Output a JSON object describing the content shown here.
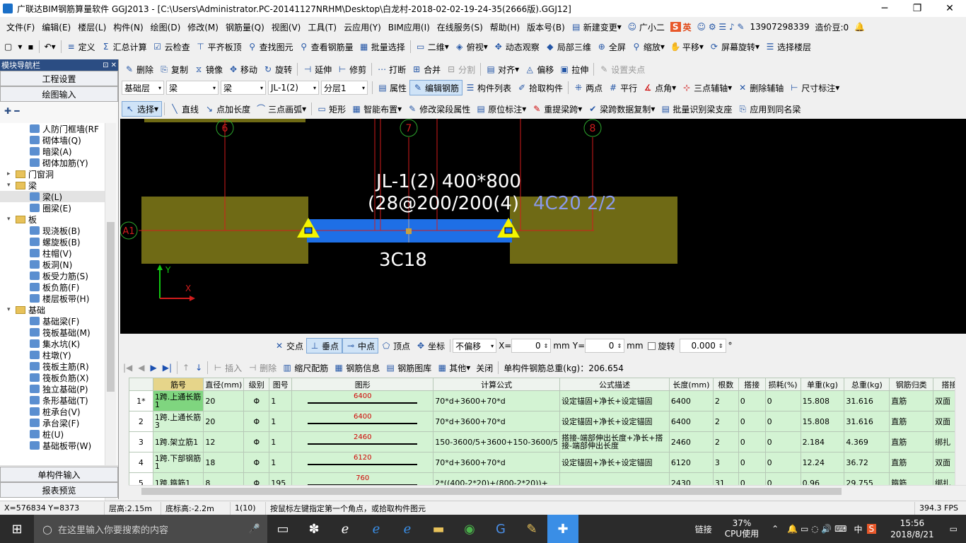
{
  "window": {
    "title": "广联达BIM钢筋算量软件 GGJ2013 - [C:\\Users\\Administrator.PC-20141127NRHM\\Desktop\\白龙村-2018-02-02-19-24-35(2666版).GGJ12]"
  },
  "menu": [
    "文件(F)",
    "编辑(E)",
    "楼层(L)",
    "构件(N)",
    "绘图(D)",
    "修改(M)",
    "钢筋量(Q)",
    "视图(V)",
    "工具(T)",
    "云应用(Y)",
    "BIM应用(I)",
    "在线服务(S)",
    "帮助(H)",
    "版本号(B)"
  ],
  "menu_right": {
    "new_change": "新建变更",
    "guang": "广小二",
    "ime": "英",
    "phone": "13907298339",
    "price": "造价豆:0"
  },
  "toolbar1": [
    "定义",
    "汇总计算",
    "云检查",
    "平齐板顶",
    "查找图元",
    "查看钢筋量",
    "批量选择",
    "二维",
    "俯视",
    "动态观察",
    "局部三维",
    "全屏",
    "缩放",
    "平移",
    "屏幕旋转",
    "选择楼层"
  ],
  "toolbar2": [
    "删除",
    "复制",
    "镜像",
    "移动",
    "旋转",
    "延伸",
    "修剪",
    "打断",
    "合并",
    "分割",
    "对齐",
    "偏移",
    "拉伸",
    "设置夹点"
  ],
  "toolbar3": {
    "floor": "基础层",
    "cat1": "梁",
    "cat2": "梁",
    "elem": "JL-1(2)",
    "layer": "分层1",
    "items": [
      "属性",
      "编辑钢筋",
      "构件列表",
      "拾取构件",
      "两点",
      "平行",
      "点角",
      "三点辅轴",
      "删除辅轴",
      "尺寸标注"
    ]
  },
  "toolbar4": [
    "选择",
    "直线",
    "点加长度",
    "三点画弧",
    "矩形",
    "智能布置",
    "修改梁段属性",
    "原位标注",
    "重提梁跨",
    "梁跨数据复制",
    "批量识别梁支座",
    "应用到同名梁"
  ],
  "nav": {
    "header": "模块导航栏",
    "buttons": [
      "工程设置",
      "绘图输入"
    ],
    "bottom": [
      "单构件输入",
      "报表预览"
    ],
    "tree": [
      {
        "label": "人防门框墙(RF",
        "indent": 3,
        "type": "item"
      },
      {
        "label": "砌体墙(Q)",
        "indent": 3,
        "type": "item"
      },
      {
        "label": "暗梁(A)",
        "indent": 3,
        "type": "item"
      },
      {
        "label": "砌体加筋(Y)",
        "indent": 3,
        "type": "item"
      },
      {
        "label": "门窗洞",
        "indent": 1,
        "type": "folder",
        "exp": ">"
      },
      {
        "label": "梁",
        "indent": 1,
        "type": "folder",
        "exp": "v"
      },
      {
        "label": "梁(L)",
        "indent": 3,
        "type": "item",
        "sel": true
      },
      {
        "label": "圈梁(E)",
        "indent": 3,
        "type": "item"
      },
      {
        "label": "板",
        "indent": 1,
        "type": "folder",
        "exp": "v"
      },
      {
        "label": "现浇板(B)",
        "indent": 3,
        "type": "item"
      },
      {
        "label": "螺旋板(B)",
        "indent": 3,
        "type": "item"
      },
      {
        "label": "柱帽(V)",
        "indent": 3,
        "type": "item"
      },
      {
        "label": "板洞(N)",
        "indent": 3,
        "type": "item"
      },
      {
        "label": "板受力筋(S)",
        "indent": 3,
        "type": "item"
      },
      {
        "label": "板负筋(F)",
        "indent": 3,
        "type": "item"
      },
      {
        "label": "楼层板带(H)",
        "indent": 3,
        "type": "item"
      },
      {
        "label": "基础",
        "indent": 1,
        "type": "folder",
        "exp": "v"
      },
      {
        "label": "基础梁(F)",
        "indent": 3,
        "type": "item"
      },
      {
        "label": "筏板基础(M)",
        "indent": 3,
        "type": "item"
      },
      {
        "label": "集水坑(K)",
        "indent": 3,
        "type": "item"
      },
      {
        "label": "柱墩(Y)",
        "indent": 3,
        "type": "item"
      },
      {
        "label": "筏板主筋(R)",
        "indent": 3,
        "type": "item"
      },
      {
        "label": "筏板负筋(X)",
        "indent": 3,
        "type": "item"
      },
      {
        "label": "独立基础(P)",
        "indent": 3,
        "type": "item"
      },
      {
        "label": "条形基础(T)",
        "indent": 3,
        "type": "item"
      },
      {
        "label": "桩承台(V)",
        "indent": 3,
        "type": "item"
      },
      {
        "label": "承台梁(F)",
        "indent": 3,
        "type": "item"
      },
      {
        "label": "桩(U)",
        "indent": 3,
        "type": "item"
      },
      {
        "label": "基础板带(W)",
        "indent": 3,
        "type": "item"
      }
    ]
  },
  "drawing": {
    "axis6": "6",
    "axis7": "7",
    "axis8": "8",
    "axisA1": "A1",
    "beam_name": "JL-1(2) 400*800",
    "stirrup": "(28@200/200(4)",
    "top_bar": "4C20 2/2",
    "bottom_bar": "3C18",
    "axis_y": "Y",
    "axis_x": "X"
  },
  "snapbar": {
    "items": [
      "交点",
      "垂点",
      "中点",
      "顶点",
      "坐标"
    ],
    "offset": "不偏移",
    "x_label": "X=",
    "x_val": "0",
    "mm1": "mm",
    "y_label": "Y=",
    "y_val": "0",
    "mm2": "mm",
    "rotate": "旋转",
    "rot_val": "0.000",
    "deg": "°"
  },
  "gridtoolbar": {
    "items": [
      "插入",
      "删除",
      "缩尺配筋",
      "钢筋信息",
      "钢筋图库",
      "其他",
      "关闭"
    ],
    "total": "单构件钢筋总重(kg)：206.654"
  },
  "grid": {
    "headers": [
      "筋号",
      "直径(mm)",
      "级别",
      "图号",
      "图形",
      "计算公式",
      "公式描述",
      "长度(mm)",
      "根数",
      "搭接",
      "损耗(%)",
      "单重(kg)",
      "总重(kg)",
      "钢筋归类",
      "搭接"
    ],
    "rows": [
      {
        "num": "1*",
        "name": "1跨.上通长筋1",
        "dia": "20",
        "grade": "Φ",
        "fig": "1",
        "shape": "6400",
        "formula": "70*d+3600+70*d",
        "desc": "设定锚固+净长+设定锚固",
        "len": "6400",
        "count": "2",
        "lap": "0",
        "loss": "0",
        "unit": "15.808",
        "total": "31.616",
        "cls": "直筋",
        "lap2": "双面"
      },
      {
        "num": "2",
        "name": "1跨.上通长筋3",
        "dia": "20",
        "grade": "Φ",
        "fig": "1",
        "shape": "6400",
        "formula": "70*d+3600+70*d",
        "desc": "设定锚固+净长+设定锚固",
        "len": "6400",
        "count": "2",
        "lap": "0",
        "loss": "0",
        "unit": "15.808",
        "total": "31.616",
        "cls": "直筋",
        "lap2": "双面"
      },
      {
        "num": "3",
        "name": "1跨.架立筋1",
        "dia": "12",
        "grade": "Φ",
        "fig": "1",
        "shape": "2460",
        "formula": "150-3600/5+3600+150-3600/5",
        "desc": "搭接-端部伸出长度+净长+搭接-端部伸出长度",
        "len": "2460",
        "count": "2",
        "lap": "0",
        "loss": "0",
        "unit": "2.184",
        "total": "4.369",
        "cls": "直筋",
        "lap2": "绑扎"
      },
      {
        "num": "4",
        "name": "1跨.下部钢筋1",
        "dia": "18",
        "grade": "Φ",
        "fig": "1",
        "shape": "6120",
        "formula": "70*d+3600+70*d",
        "desc": "设定锚固+净长+设定锚固",
        "len": "6120",
        "count": "3",
        "lap": "0",
        "loss": "0",
        "unit": "12.24",
        "total": "36.72",
        "cls": "直筋",
        "lap2": "双面"
      },
      {
        "num": "5",
        "name": "1跨.箍筋1",
        "dia": "8",
        "grade": "Φ",
        "fig": "195",
        "shape": "760",
        "formula": "2*((400-2*20)+(800-2*20))+",
        "desc": "",
        "len": "2430",
        "count": "31",
        "lap": "0",
        "loss": "0",
        "unit": "0.96",
        "total": "29.755",
        "cls": "箍筋",
        "lap2": "绑扎"
      }
    ]
  },
  "status": {
    "coord": "X=576834 Y=8373",
    "floor_h": "层高:2.15m",
    "bottom_h": "底标高:-2.2m",
    "count": "1(10)",
    "hint": "按鼠标左键指定第一个角点，或拾取构件图元",
    "fps": "394.3 FPS"
  },
  "taskbar": {
    "search": "在这里输入你要搜索的内容",
    "link": "链接",
    "cpu": "37%",
    "cpu_label": "CPU使用",
    "lang": "中",
    "time": "15:56",
    "date": "2018/8/21"
  }
}
